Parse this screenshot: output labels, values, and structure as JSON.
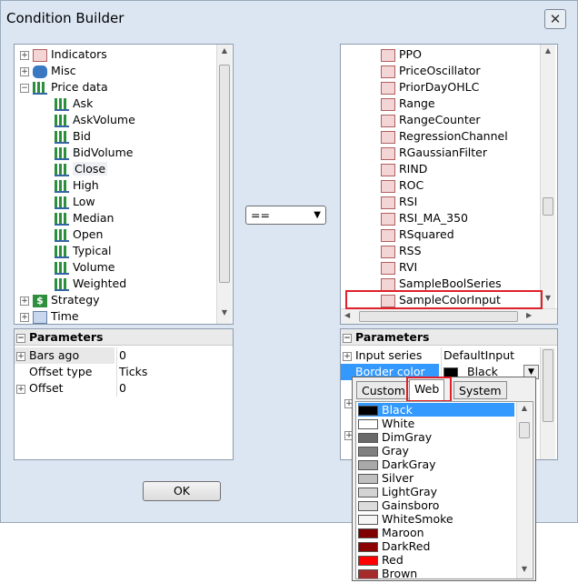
{
  "window": {
    "title": "Condition Builder",
    "close_symbol": "✕"
  },
  "left_tree": {
    "items": [
      {
        "label": "Indicators",
        "icon": "indicator-chart-icon",
        "expandable": true,
        "expand": "+"
      },
      {
        "label": "Misc",
        "icon": "database-icon",
        "expandable": true,
        "expand": "+"
      },
      {
        "label": "Price data",
        "icon": "bar-chart-icon",
        "expandable": true,
        "expand": "−"
      },
      {
        "label": "Ask",
        "icon": "bar-chart-icon",
        "child": true
      },
      {
        "label": "AskVolume",
        "icon": "bar-chart-icon",
        "child": true
      },
      {
        "label": "Bid",
        "icon": "bar-chart-icon",
        "child": true
      },
      {
        "label": "BidVolume",
        "icon": "bar-chart-icon",
        "child": true
      },
      {
        "label": "Close",
        "icon": "bar-chart-icon",
        "child": true,
        "selected": true
      },
      {
        "label": "High",
        "icon": "bar-chart-icon",
        "child": true
      },
      {
        "label": "Low",
        "icon": "bar-chart-icon",
        "child": true
      },
      {
        "label": "Median",
        "icon": "bar-chart-icon",
        "child": true
      },
      {
        "label": "Open",
        "icon": "bar-chart-icon",
        "child": true
      },
      {
        "label": "Typical",
        "icon": "bar-chart-icon",
        "child": true
      },
      {
        "label": "Volume",
        "icon": "bar-chart-icon",
        "child": true
      },
      {
        "label": "Weighted",
        "icon": "bar-chart-icon",
        "child": true
      },
      {
        "label": "Strategy",
        "icon": "dollar-icon",
        "expandable": true,
        "expand": "+"
      },
      {
        "label": "Time",
        "icon": "clock-icon",
        "expandable": true,
        "expand": "+"
      }
    ]
  },
  "left_params": {
    "header": "Parameters",
    "rows": [
      {
        "name": "Bars ago",
        "value": "0",
        "expand": "+"
      },
      {
        "name": "Offset type",
        "value": "Ticks",
        "expand": ""
      },
      {
        "name": "Offset",
        "value": "0",
        "expand": "+"
      }
    ]
  },
  "operator": {
    "value": "=="
  },
  "right_list": {
    "items": [
      "PPO",
      "PriceOscillator",
      "PriorDayOHLC",
      "Range",
      "RangeCounter",
      "RegressionChannel",
      "RGaussianFilter",
      "RIND",
      "ROC",
      "RSI",
      "RSI_MA_350",
      "RSquared",
      "RSS",
      "RVI",
      "SampleBoolSeries",
      "SampleColorInput"
    ],
    "highlighted": "SampleColorInput"
  },
  "right_params": {
    "header": "Parameters",
    "rows": [
      {
        "name": "Input series",
        "value": "DefaultInput",
        "expand": "+"
      },
      {
        "name": "Border color",
        "value": "Black",
        "selected": true
      }
    ],
    "extra_expanders": [
      "+",
      "+"
    ]
  },
  "color_dropdown": {
    "tabs": [
      "Custom",
      "Web",
      "System"
    ],
    "active_tab": "Web",
    "colors": [
      {
        "name": "Black",
        "hex": "#000000"
      },
      {
        "name": "White",
        "hex": "#ffffff"
      },
      {
        "name": "DimGray",
        "hex": "#696969"
      },
      {
        "name": "Gray",
        "hex": "#808080"
      },
      {
        "name": "DarkGray",
        "hex": "#a9a9a9"
      },
      {
        "name": "Silver",
        "hex": "#c0c0c0"
      },
      {
        "name": "LightGray",
        "hex": "#d3d3d3"
      },
      {
        "name": "Gainsboro",
        "hex": "#dcdcdc"
      },
      {
        "name": "WhiteSmoke",
        "hex": "#f5f5f5"
      },
      {
        "name": "Maroon",
        "hex": "#800000"
      },
      {
        "name": "DarkRed",
        "hex": "#8b0000"
      },
      {
        "name": "Red",
        "hex": "#ff0000"
      },
      {
        "name": "Brown",
        "hex": "#a52a2a"
      }
    ],
    "selected": "Black"
  },
  "ok_button": {
    "label": "OK"
  },
  "colors": {
    "selection_blue": "#3399ff",
    "highlight_red": "#e0202a",
    "dialog_bg": "#dbe6f2"
  }
}
